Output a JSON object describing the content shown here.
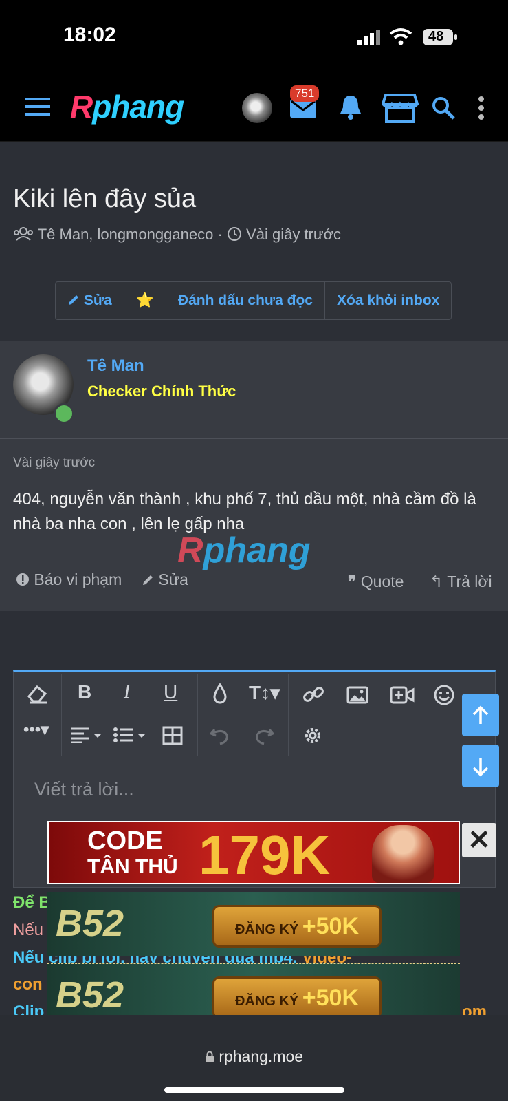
{
  "status_bar": {
    "time": "18:02",
    "battery": "48"
  },
  "nav": {
    "logo": "Rphang",
    "logo_a": "R",
    "logo_b": "phang",
    "inbox_count": "751"
  },
  "thread": {
    "title": "Kiki lên đây sủa",
    "participants": "Tê Man, longmongganeco",
    "time": "Vài giây trước",
    "buttons": {
      "edit": "Sửa",
      "star": "⭐",
      "mark_unread": "Đánh dấu chưa đọc",
      "remove_inbox": "Xóa khỏi inbox"
    }
  },
  "post": {
    "author": "Tê Man",
    "role": "Checker Chính Thức",
    "time": "Vài giây trước",
    "body": "404, nguyễn văn thành , khu phố 7, thủ dầu một, nhà cầm đồ là nhà ba nha con , lên lẹ gấp nha",
    "actions": {
      "report": "Báo vi phạm",
      "edit": "Sửa",
      "quote": "Quote",
      "reply": "Trả lời"
    }
  },
  "watermark": {
    "a": "R",
    "b": "phang"
  },
  "editor": {
    "placeholder": "Viết trả lời..."
  },
  "ads": {
    "ad1": {
      "line1": "CODE",
      "line2": "TÂN THỦ",
      "big": "179K"
    },
    "ad2": {
      "logo": "B52",
      "cta": "ĐĂNG KÝ",
      "bonus": "+50K"
    }
  },
  "notices": {
    "n1": "Để B",
    "n2": "Nếu",
    "n3": "Nếu clip bị lỗi, hãy chuyển qua mp4.",
    "n3b": "Video-",
    "n4": "con",
    "n5": "Clip",
    "n5b": "om"
  },
  "colors": {
    "accent": "#53a9f5",
    "role": "#ffff44",
    "background": "#2c2f36"
  },
  "browser": {
    "url": "rphang.moe"
  }
}
